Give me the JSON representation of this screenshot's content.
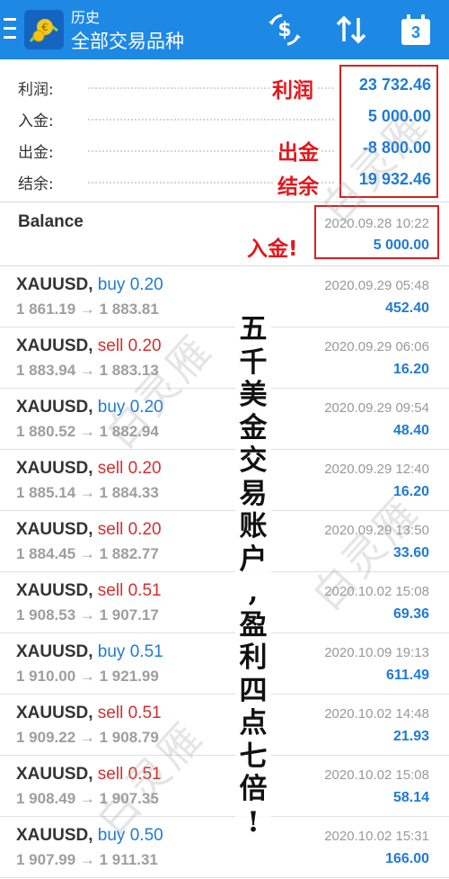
{
  "header": {
    "title": "历史",
    "subtitle": "全部交易品种",
    "calendar_day": "3",
    "icons": [
      "menu-icon",
      "app-logo",
      "currency-exchange-icon",
      "sort-icon",
      "calendar-icon"
    ],
    "bg_color": "#1e88e5"
  },
  "summary": {
    "rows": [
      {
        "label": "利润:",
        "value": "23 732.46"
      },
      {
        "label": "入金:",
        "value": "5 000.00"
      },
      {
        "label": "出金:",
        "value": "-8 800.00"
      },
      {
        "label": "结余:",
        "value": "19 932.46"
      }
    ],
    "annotations": [
      "利润",
      "出金",
      "结余"
    ]
  },
  "balance": {
    "title": "Balance",
    "time": "2020.09.28 10:22",
    "amount": "5 000.00",
    "annotation": "入金!"
  },
  "trades": [
    {
      "symbol": "XAUUSD,",
      "side": "buy",
      "lots": "0.20",
      "prices": "1 861.19 → 1 883.81",
      "time": "2020.09.29 05:48",
      "profit": "452.40"
    },
    {
      "symbol": "XAUUSD,",
      "side": "sell",
      "lots": "0.20",
      "prices": "1 883.94 → 1 883.13",
      "time": "2020.09.29 06:06",
      "profit": "16.20"
    },
    {
      "symbol": "XAUUSD,",
      "side": "buy",
      "lots": "0.20",
      "prices": "1 880.52 → 1 882.94",
      "time": "2020.09.29 09:54",
      "profit": "48.40"
    },
    {
      "symbol": "XAUUSD,",
      "side": "sell",
      "lots": "0.20",
      "prices": "1 885.14 → 1 884.33",
      "time": "2020.09.29 12:40",
      "profit": "16.20"
    },
    {
      "symbol": "XAUUSD,",
      "side": "sell",
      "lots": "0.20",
      "prices": "1 884.45 → 1 882.77",
      "time": "2020.09.29 13:50",
      "profit": "33.60"
    },
    {
      "symbol": "XAUUSD,",
      "side": "sell",
      "lots": "0.51",
      "prices": "1 908.53 → 1 907.17",
      "time": "2020.10.02 15:08",
      "profit": "69.36"
    },
    {
      "symbol": "XAUUSD,",
      "side": "buy",
      "lots": "0.51",
      "prices": "1 910.00 → 1 921.99",
      "time": "2020.10.09 19:13",
      "profit": "611.49"
    },
    {
      "symbol": "XAUUSD,",
      "side": "sell",
      "lots": "0.51",
      "prices": "1 909.22 → 1 908.79",
      "time": "2020.10.02 14:48",
      "profit": "21.93"
    },
    {
      "symbol": "XAUUSD,",
      "side": "sell",
      "lots": "0.51",
      "prices": "1 908.49 → 1 907.35",
      "time": "2020.10.02 15:08",
      "profit": "58.14"
    },
    {
      "symbol": "XAUUSD,",
      "side": "buy",
      "lots": "0.50",
      "prices": "1 907.99 → 1 911.31",
      "time": "2020.10.02 15:31",
      "profit": "166.00"
    }
  ],
  "overlay_text": "五千美金交易账户,盈利四点七倍!",
  "watermark": "白灵雁",
  "colors": {
    "profit_blue": "#1e7bd6",
    "sell_red": "#d32f2f",
    "annotation_red": "#e4161b"
  }
}
